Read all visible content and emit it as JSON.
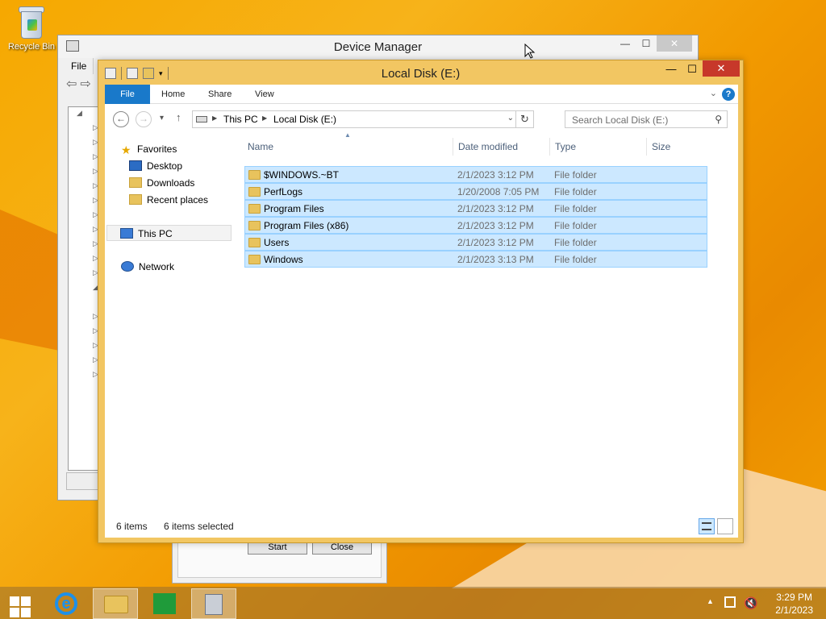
{
  "desktop": {
    "recycle_bin_label": "Recycle Bin"
  },
  "device_manager": {
    "title": "Device Manager",
    "menu_file": "File",
    "minimize": "—",
    "maximize": "☐",
    "close": "✕"
  },
  "dialog": {
    "start_label": "Start",
    "close_label": "Close"
  },
  "explorer": {
    "title": "Local Disk (E:)",
    "minimize": "—",
    "maximize": "☐",
    "close": "✕",
    "ribbon": {
      "file": "File",
      "home": "Home",
      "share": "Share",
      "view": "View",
      "help": "?"
    },
    "breadcrumb": {
      "this_pc": "This PC",
      "current": "Local Disk (E:)"
    },
    "search_placeholder": "Search Local Disk (E:)",
    "nav": {
      "favorites": "Favorites",
      "desktop": "Desktop",
      "downloads": "Downloads",
      "recent": "Recent places",
      "this_pc": "This PC",
      "network": "Network"
    },
    "columns": {
      "name": "Name",
      "date": "Date modified",
      "type": "Type",
      "size": "Size"
    },
    "files": [
      {
        "name": "$WINDOWS.~BT",
        "date": "2/1/2023 3:12 PM",
        "type": "File folder"
      },
      {
        "name": "PerfLogs",
        "date": "1/20/2008 7:05 PM",
        "type": "File folder"
      },
      {
        "name": "Program Files",
        "date": "2/1/2023 3:12 PM",
        "type": "File folder"
      },
      {
        "name": "Program Files (x86)",
        "date": "2/1/2023 3:12 PM",
        "type": "File folder"
      },
      {
        "name": "Users",
        "date": "2/1/2023 3:12 PM",
        "type": "File folder"
      },
      {
        "name": "Windows",
        "date": "2/1/2023 3:13 PM",
        "type": "File folder"
      }
    ],
    "status": {
      "items": "6 items",
      "selected": "6 items selected"
    }
  },
  "taskbar": {
    "clock_time": "3:29 PM",
    "clock_date": "2/1/2023"
  },
  "colors": {
    "accent": "#1979ca",
    "selection": "#cce8ff",
    "close_red": "#c7382a",
    "frame": "#f2c662"
  }
}
